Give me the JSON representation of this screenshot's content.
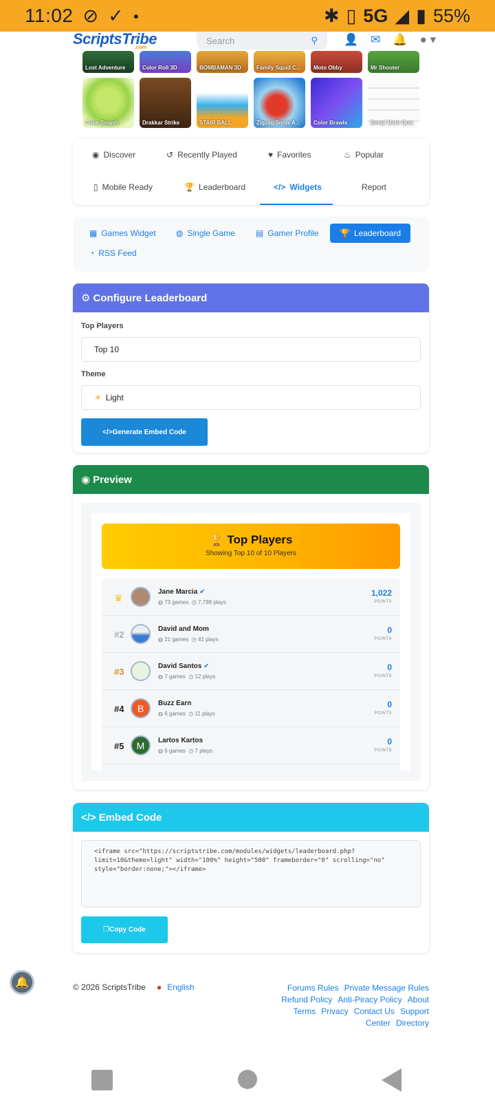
{
  "statusbar": {
    "time": "11:02",
    "network": "5G",
    "battery": "55%"
  },
  "topnav": {
    "logo": "ScriptsTribe",
    "logo_sub": ".com",
    "search_placeholder": "Search"
  },
  "games_row1": [
    "Lost Adventure",
    "Color Roll 3D",
    "BOMBAMAN 3D",
    "Family Squid C...",
    "Moto Obby",
    "Mr Shooter"
  ],
  "games_row2": [
    "Cube Smash",
    "Drakkar Strike",
    "STAIR BALL",
    "Zigzag Snow A...",
    "Color Brawls",
    "Emoji Math Quiz"
  ],
  "tabs": [
    "Discover",
    "Recently Played",
    "Favorites",
    "Popular",
    "Mobile Ready",
    "Leaderboard",
    "Widgets",
    "Report"
  ],
  "subtabs": [
    "Games Widget",
    "Single Game",
    "Gamer Profile",
    "Leaderboard",
    "RSS Feed"
  ],
  "configure": {
    "title": "Configure Leaderboard",
    "top_players_label": "Top Players",
    "top_players_value": "Top 10",
    "theme_label": "Theme",
    "theme_value": "Light",
    "generate_button": "Generate Embed Code"
  },
  "preview": {
    "title": "Preview",
    "banner_title": "Top Players",
    "banner_subtitle": "Showing Top 10 of 10 Players",
    "players": [
      {
        "rank": "",
        "name": "Jane Marcia",
        "games": "73 games",
        "plays": "7,798 plays",
        "points": "1,022",
        "points_label": "POINTS"
      },
      {
        "rank": "#2",
        "name": "David and Mom",
        "games": "21 games",
        "plays": "41 plays",
        "points": "0",
        "points_label": "POINTS"
      },
      {
        "rank": "#3",
        "name": "David Santos",
        "games": "7 games",
        "plays": "12 plays",
        "points": "0",
        "points_label": "POINTS"
      },
      {
        "rank": "#4",
        "name": "Buzz Earn",
        "games": "6 games",
        "plays": "11 plays",
        "points": "0",
        "points_label": "POINTS",
        "initial": "B"
      },
      {
        "rank": "#5",
        "name": "Lartos Kartos",
        "games": "6 games",
        "plays": "7 plays",
        "points": "0",
        "points_label": "POINTS",
        "initial": "M"
      }
    ]
  },
  "embed": {
    "title": "Embed Code",
    "code": "<iframe src=\"https://scriptstribe.com/modules/widgets/leaderboard.php?limit=10&theme=light\" width=\"100%\" height=\"500\" frameborder=\"0\" scrolling=\"no\" style=\"border:none;\"></iframe>",
    "copy_button": "Copy Code"
  },
  "footer": {
    "copyright": "© 2026 ScriptsTribe",
    "language": "English",
    "links": [
      "Forums Rules",
      "Private Message Rules",
      "Refund Policy",
      "Anti-Piracy Policy",
      "About",
      "Terms",
      "Privacy",
      "Contact Us",
      "Support",
      "Center",
      "Directory"
    ]
  },
  "colors": {
    "statusbar": "#f7a823",
    "configure_header": "#6072e6",
    "preview_header": "#1d8a4c",
    "embed_header": "#1ec8eb",
    "accent": "#1b7ee6"
  }
}
